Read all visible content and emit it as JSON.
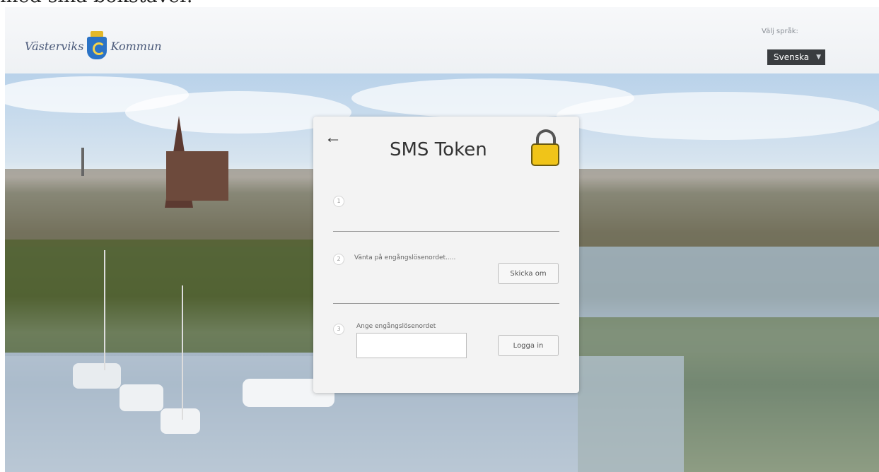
{
  "caption": {
    "text": "med sina bokstäver."
  },
  "header": {
    "logo_left": "Västerviks",
    "logo_right": "Kommun",
    "language": {
      "label": "Välj språk:",
      "selected": "Svenska"
    }
  },
  "card": {
    "title": "SMS Token",
    "steps": [
      {
        "number": "1",
        "text": ""
      },
      {
        "number": "2",
        "text": "Vänta på engångslösenordet.....",
        "button": "Skicka om"
      },
      {
        "number": "3",
        "text": "Ange engångslösenordet",
        "input_value": "",
        "button": "Logga in"
      }
    ]
  },
  "icons": {
    "back": "back-arrow-icon",
    "lock": "padlock-icon",
    "crest": "municipal-crest-icon",
    "chevron": "chevron-down-icon"
  },
  "colors": {
    "lock_yellow": "#f0c419",
    "crest_blue": "#2b73c6",
    "language_select_bg": "#3a3d40"
  }
}
